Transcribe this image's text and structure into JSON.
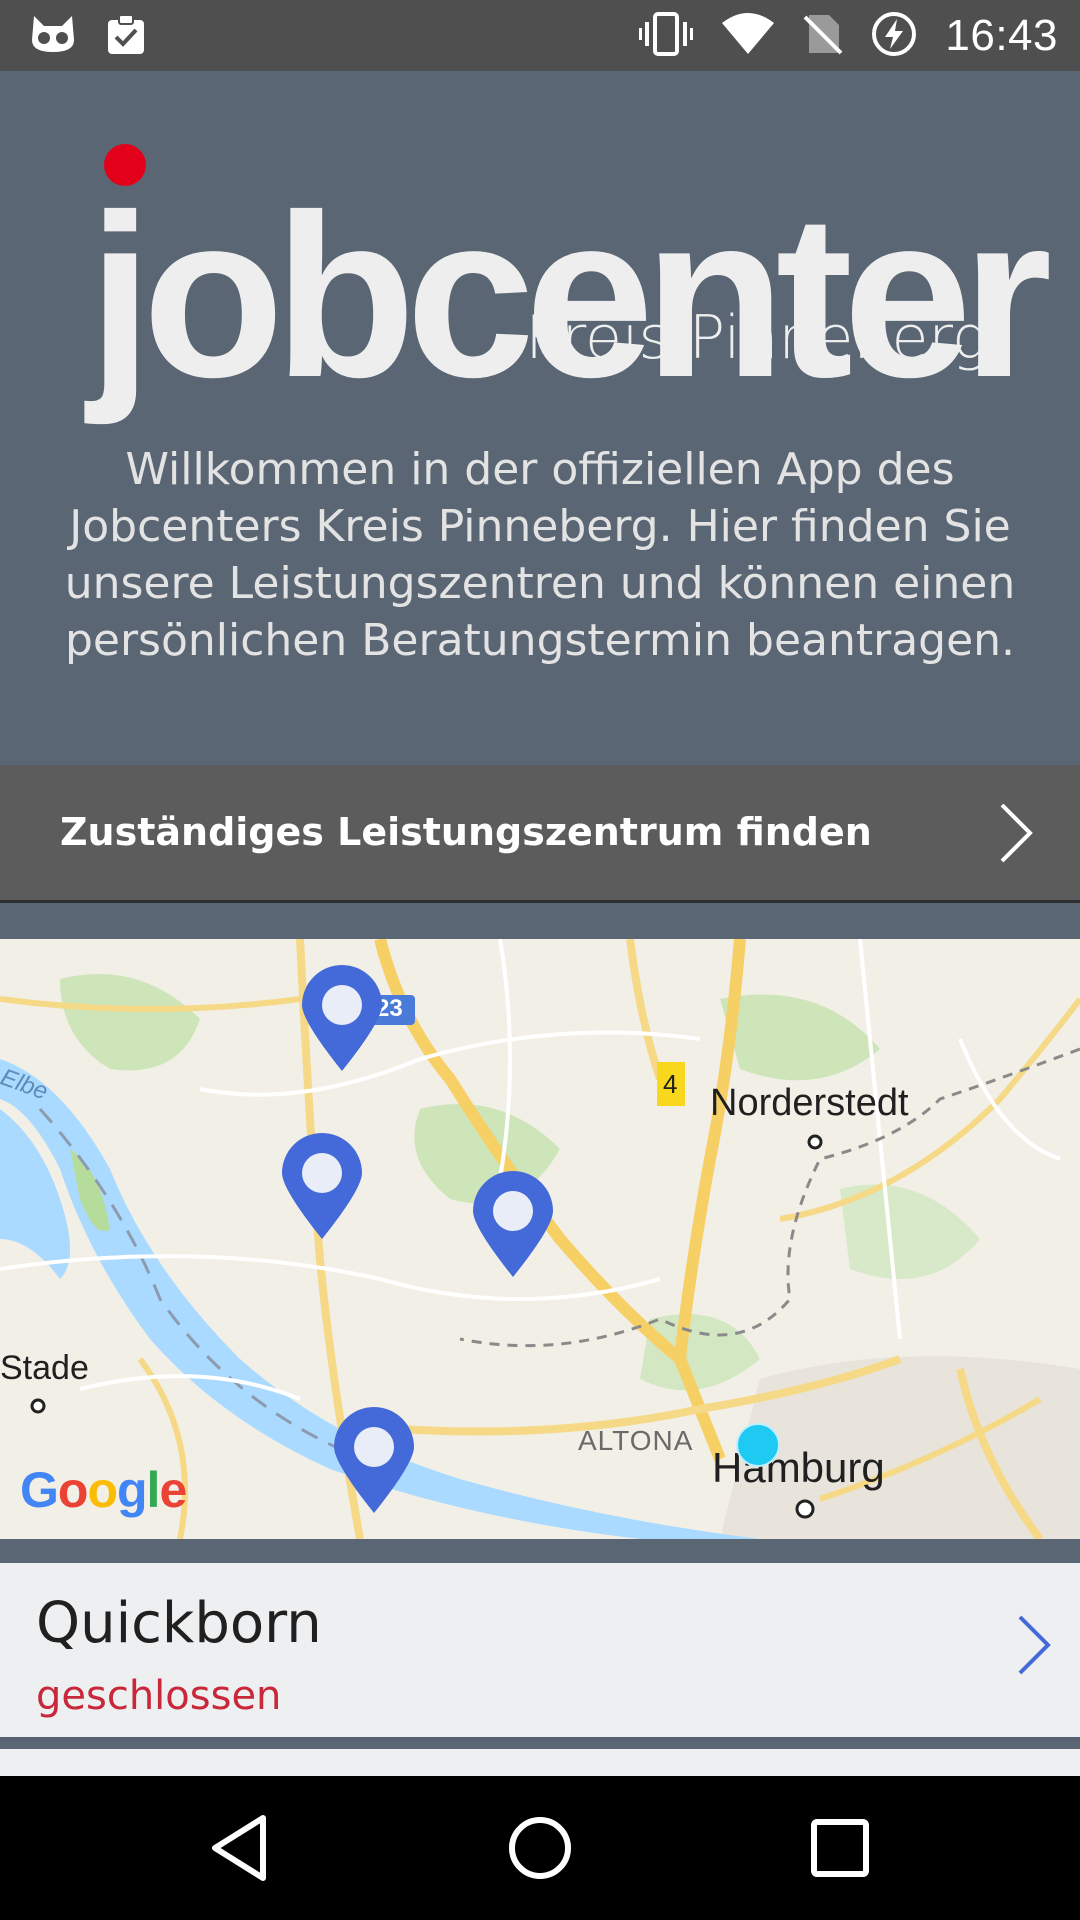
{
  "status_bar": {
    "time": "16:43",
    "left_icons": [
      "cat-face-icon",
      "clipboard-check-icon"
    ],
    "right_icons": [
      "vibrate-icon",
      "wifi-icon",
      "no-sim-icon",
      "battery-charging-icon"
    ]
  },
  "header": {
    "logo_word": "jobcenter",
    "logo_subtitle": "Kreis Pinneberg",
    "welcome_text": "Willkommen in der offiziellen App des Jobcenters Kreis Pinneberg. Hier finden Sie unsere Leistungszentren und können einen persönlichen Beratungstermin beantragen."
  },
  "find_center": {
    "label": "Zuständiges Leistungszentrum finden",
    "icon": "chevron-right-icon"
  },
  "map": {
    "labels": {
      "norderstedt": "Norderstedt",
      "stade": "Stade",
      "altona": "ALTONA",
      "hamburg": "Hamburg",
      "elbe": "Elbe",
      "road_23": "23",
      "road_4": "4"
    },
    "google_letters": [
      "G",
      "o",
      "o",
      "g",
      "l",
      "e"
    ],
    "colors": {
      "pin": "#4469d8",
      "water": "#aadaff",
      "road": "#f6cf65",
      "park": "#c9e3b5",
      "current_location": "#1ec9f2"
    }
  },
  "locations": [
    {
      "name": "Quickborn",
      "status": "geschlossen",
      "status_color": "#c8283a"
    }
  ],
  "nav_bar": {
    "icons": [
      "back-icon",
      "home-icon",
      "recents-icon"
    ]
  }
}
